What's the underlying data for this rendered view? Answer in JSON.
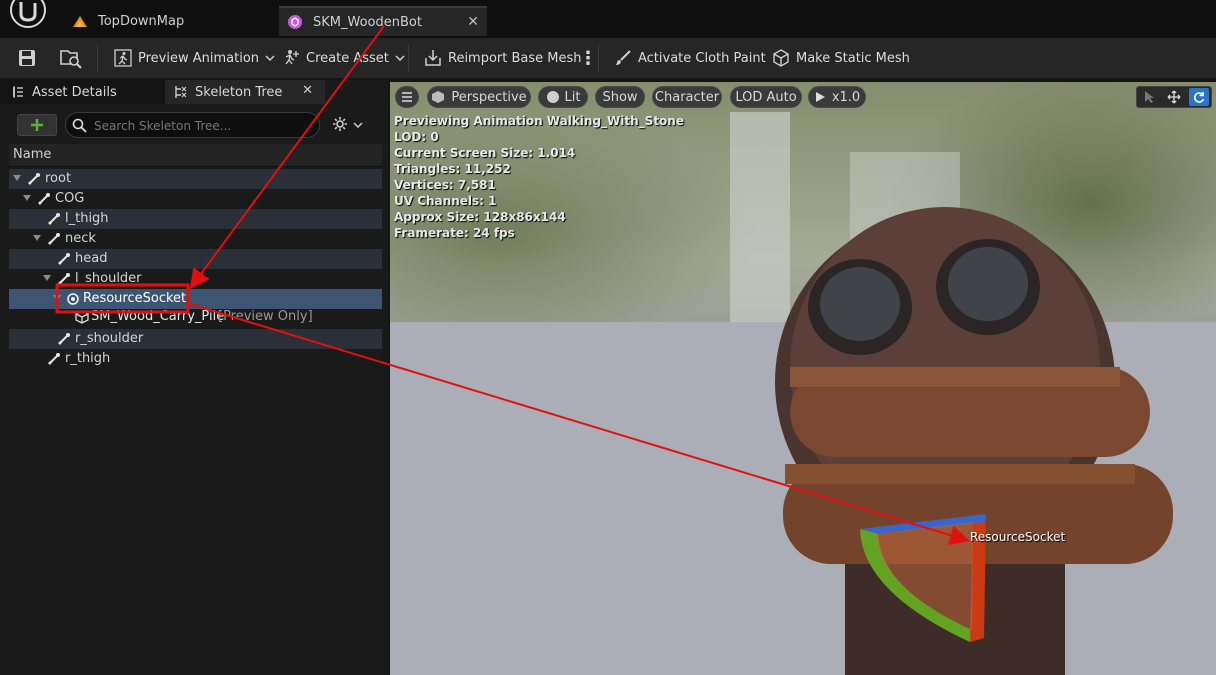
{
  "tabs": [
    {
      "label": "TopDownMap",
      "icon": "level-icon"
    },
    {
      "label": "SKM_WoodenBot",
      "icon": "skeletal-mesh-icon"
    }
  ],
  "toolbar": {
    "preview_animation": "Preview Animation",
    "create_asset": "Create Asset",
    "reimport": "Reimport Base Mesh",
    "cloth_paint": "Activate Cloth Paint",
    "static_mesh": "Make Static Mesh"
  },
  "panel": {
    "asset_details": "Asset Details",
    "skeleton_tree": "Skeleton Tree",
    "search_placeholder": "Search Skeleton Tree...",
    "column_name": "Name"
  },
  "tree": {
    "root": "root",
    "cog": "COG",
    "l_thigh": "l_thigh",
    "neck": "neck",
    "head": "head",
    "l_shoulder": "l_shoulder",
    "socket": "ResourceSocket",
    "preview_mesh": "SM_Wood_Carry_Pile",
    "preview_tag": "[Preview Only]",
    "r_shoulder": "r_shoulder",
    "r_thigh": "r_thigh"
  },
  "viewport": {
    "perspective": "Perspective",
    "lit": "Lit",
    "show": "Show",
    "character": "Character",
    "lod": "LOD Auto",
    "play_rate": "x1.0",
    "stats": [
      "Previewing Animation Walking_With_Stone",
      "LOD: 0",
      "Current Screen Size: 1.014",
      "Triangles: 11,252",
      "Vertices: 7,581",
      "UV Channels: 1",
      "Approx Size: 128x86x144",
      "Framerate: 24 fps"
    ],
    "socket_label": "ResourceSocket"
  },
  "colors": {
    "annotation": "#e01010",
    "selection": "#3d5573",
    "add_button": "#56b33d"
  }
}
